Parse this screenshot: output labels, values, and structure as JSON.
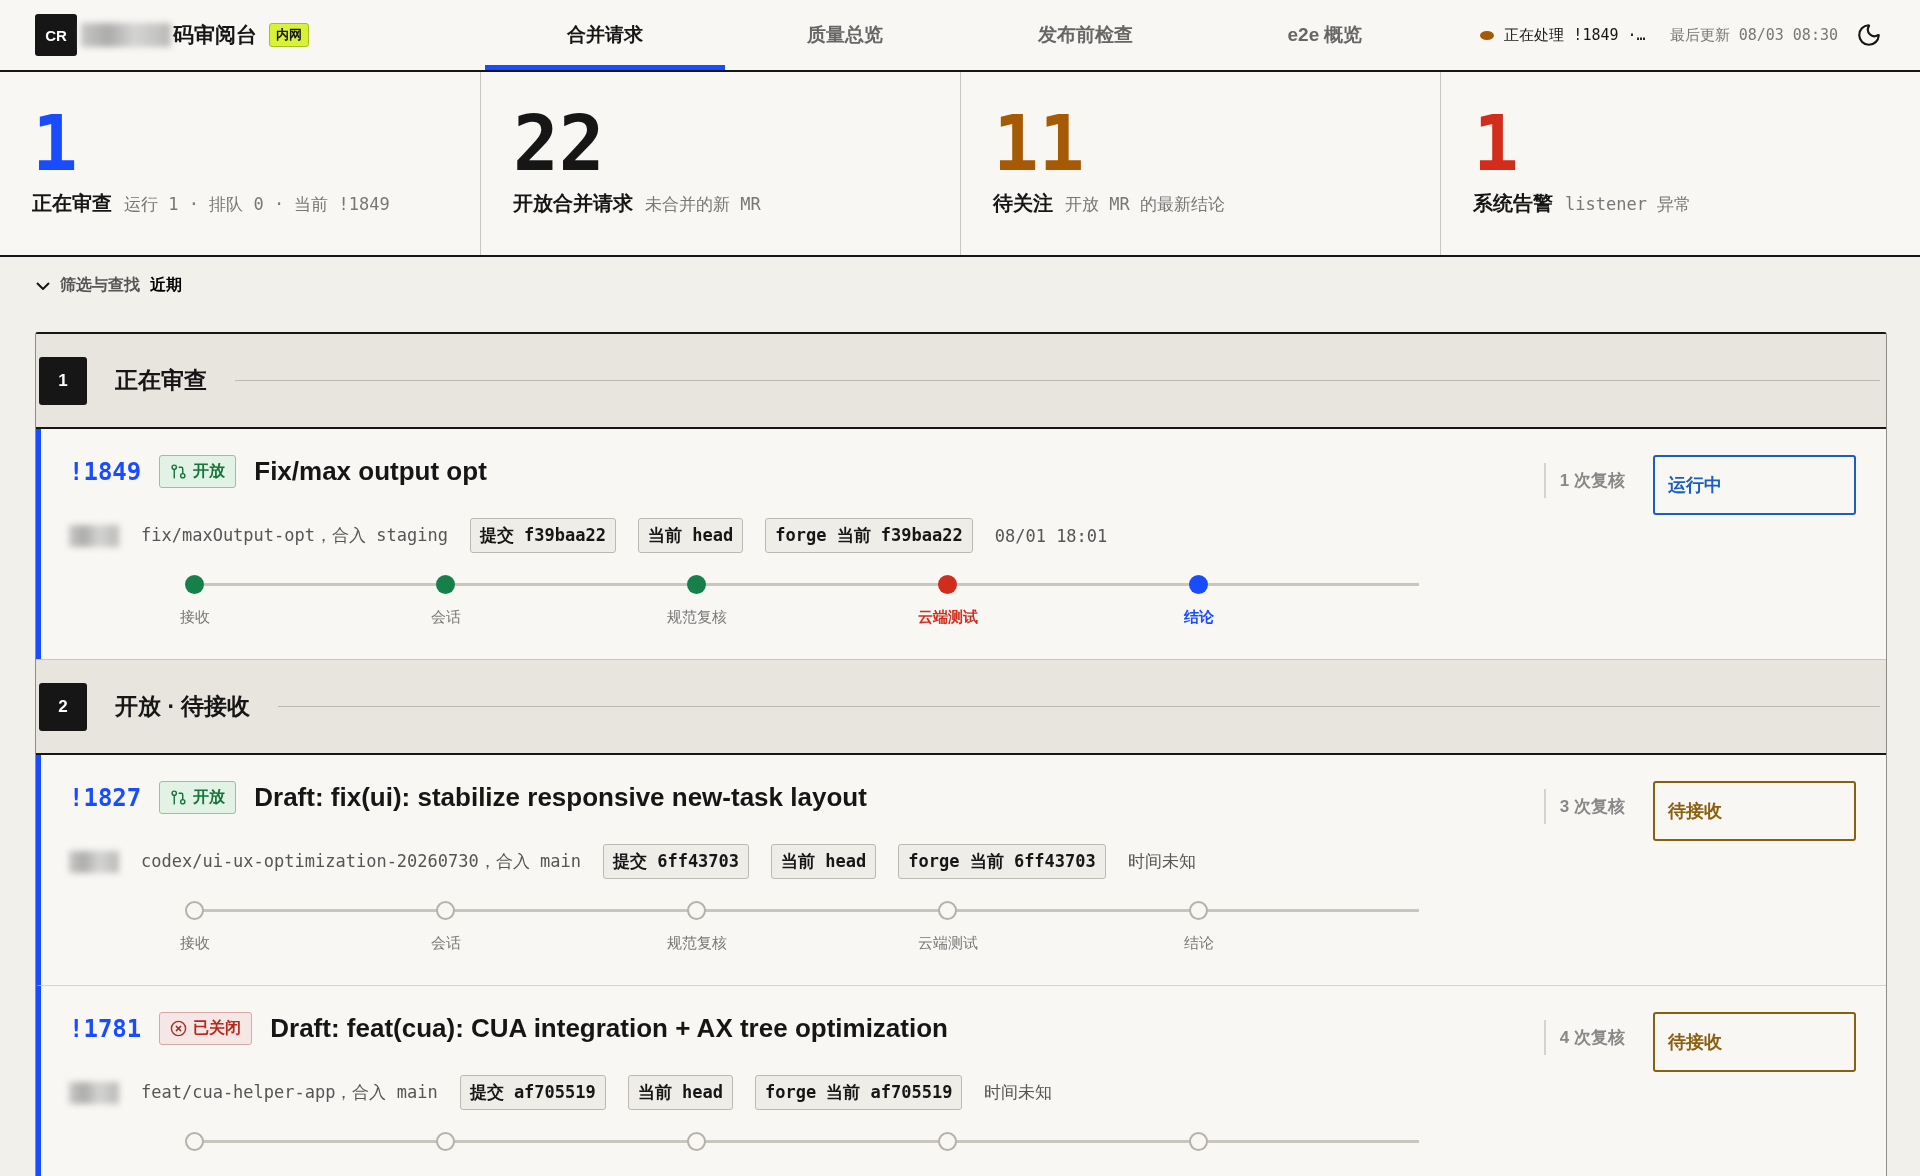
{
  "header": {
    "logo": "CR",
    "title": "码审阅台",
    "env_badge": "内网",
    "tabs": [
      {
        "label": "合并请求",
        "selected": true
      },
      {
        "label": "质量总览",
        "selected": false
      },
      {
        "label": "发布前检查",
        "selected": false
      },
      {
        "label": "e2e 概览",
        "selected": false
      }
    ],
    "status": {
      "text": "正在处理 !1849 ·…",
      "updated": "最后更新 08/03 08:30"
    }
  },
  "stats": [
    {
      "value": "1",
      "label": "正在审查",
      "detail": "运行 1 · 排队 0 · 当前 !1849",
      "color": "#1a4cff"
    },
    {
      "value": "22",
      "label": "开放合并请求",
      "detail": "未合并的新 MR",
      "color": "#161616"
    },
    {
      "value": "11",
      "label": "待关注",
      "detail": "开放 MR 的最新结论",
      "color": "#a65a05"
    },
    {
      "value": "1",
      "label": "系统告警",
      "detail": "listener 异常",
      "color": "#d22d1c"
    }
  ],
  "filter": {
    "label": "筛选与查找",
    "value": "近期",
    "expanded": false
  },
  "sections": [
    {
      "index": "1",
      "title": "正在审查",
      "items": [
        {
          "id": "!1849",
          "badge": {
            "kind": "open",
            "label": "开放"
          },
          "title": "Fix/max output opt",
          "branch": "fix/maxOutput-opt，合入 staging",
          "chips": [
            "提交 f39baa22",
            "当前 head",
            "forge 当前 f39baa22"
          ],
          "time": "08/01 18:01",
          "reviews": "1 次复核",
          "status": {
            "kind": "running",
            "label": "运行中"
          },
          "stages": [
            {
              "label": "接收",
              "kind": "done"
            },
            {
              "label": "会话",
              "kind": "done"
            },
            {
              "label": "规范复核",
              "kind": "done"
            },
            {
              "label": "云端测试",
              "kind": "failed"
            },
            {
              "label": "结论",
              "kind": "current"
            }
          ]
        }
      ]
    },
    {
      "index": "2",
      "title": "开放 · 待接收",
      "items": [
        {
          "id": "!1827",
          "badge": {
            "kind": "open",
            "label": "开放"
          },
          "title": "Draft: fix(ui): stabilize responsive new-task layout",
          "branch": "codex/ui-ux-optimization-20260730，合入 main",
          "chips": [
            "提交 6ff43703",
            "当前 head",
            "forge 当前 6ff43703"
          ],
          "time": "时间未知",
          "reviews": "3 次复核",
          "status": {
            "kind": "waiting",
            "label": "待接收"
          },
          "stages": [
            {
              "label": "接收",
              "kind": "pending"
            },
            {
              "label": "会话",
              "kind": "pending"
            },
            {
              "label": "规范复核",
              "kind": "pending"
            },
            {
              "label": "云端测试",
              "kind": "pending"
            },
            {
              "label": "结论",
              "kind": "pending"
            }
          ]
        },
        {
          "id": "!1781",
          "badge": {
            "kind": "closed",
            "label": "已关闭"
          },
          "title": "Draft: feat(cua): CUA integration + AX tree optimization",
          "branch": "feat/cua-helper-app，合入 main",
          "chips": [
            "提交 af705519",
            "当前 head",
            "forge 当前 af705519"
          ],
          "time": "时间未知",
          "reviews": "4 次复核",
          "status": {
            "kind": "waiting",
            "label": "待接收"
          },
          "stages": [
            {
              "kind": "pending"
            },
            {
              "kind": "pending"
            },
            {
              "kind": "pending"
            },
            {
              "kind": "pending"
            },
            {
              "kind": "pending"
            }
          ]
        }
      ]
    }
  ]
}
